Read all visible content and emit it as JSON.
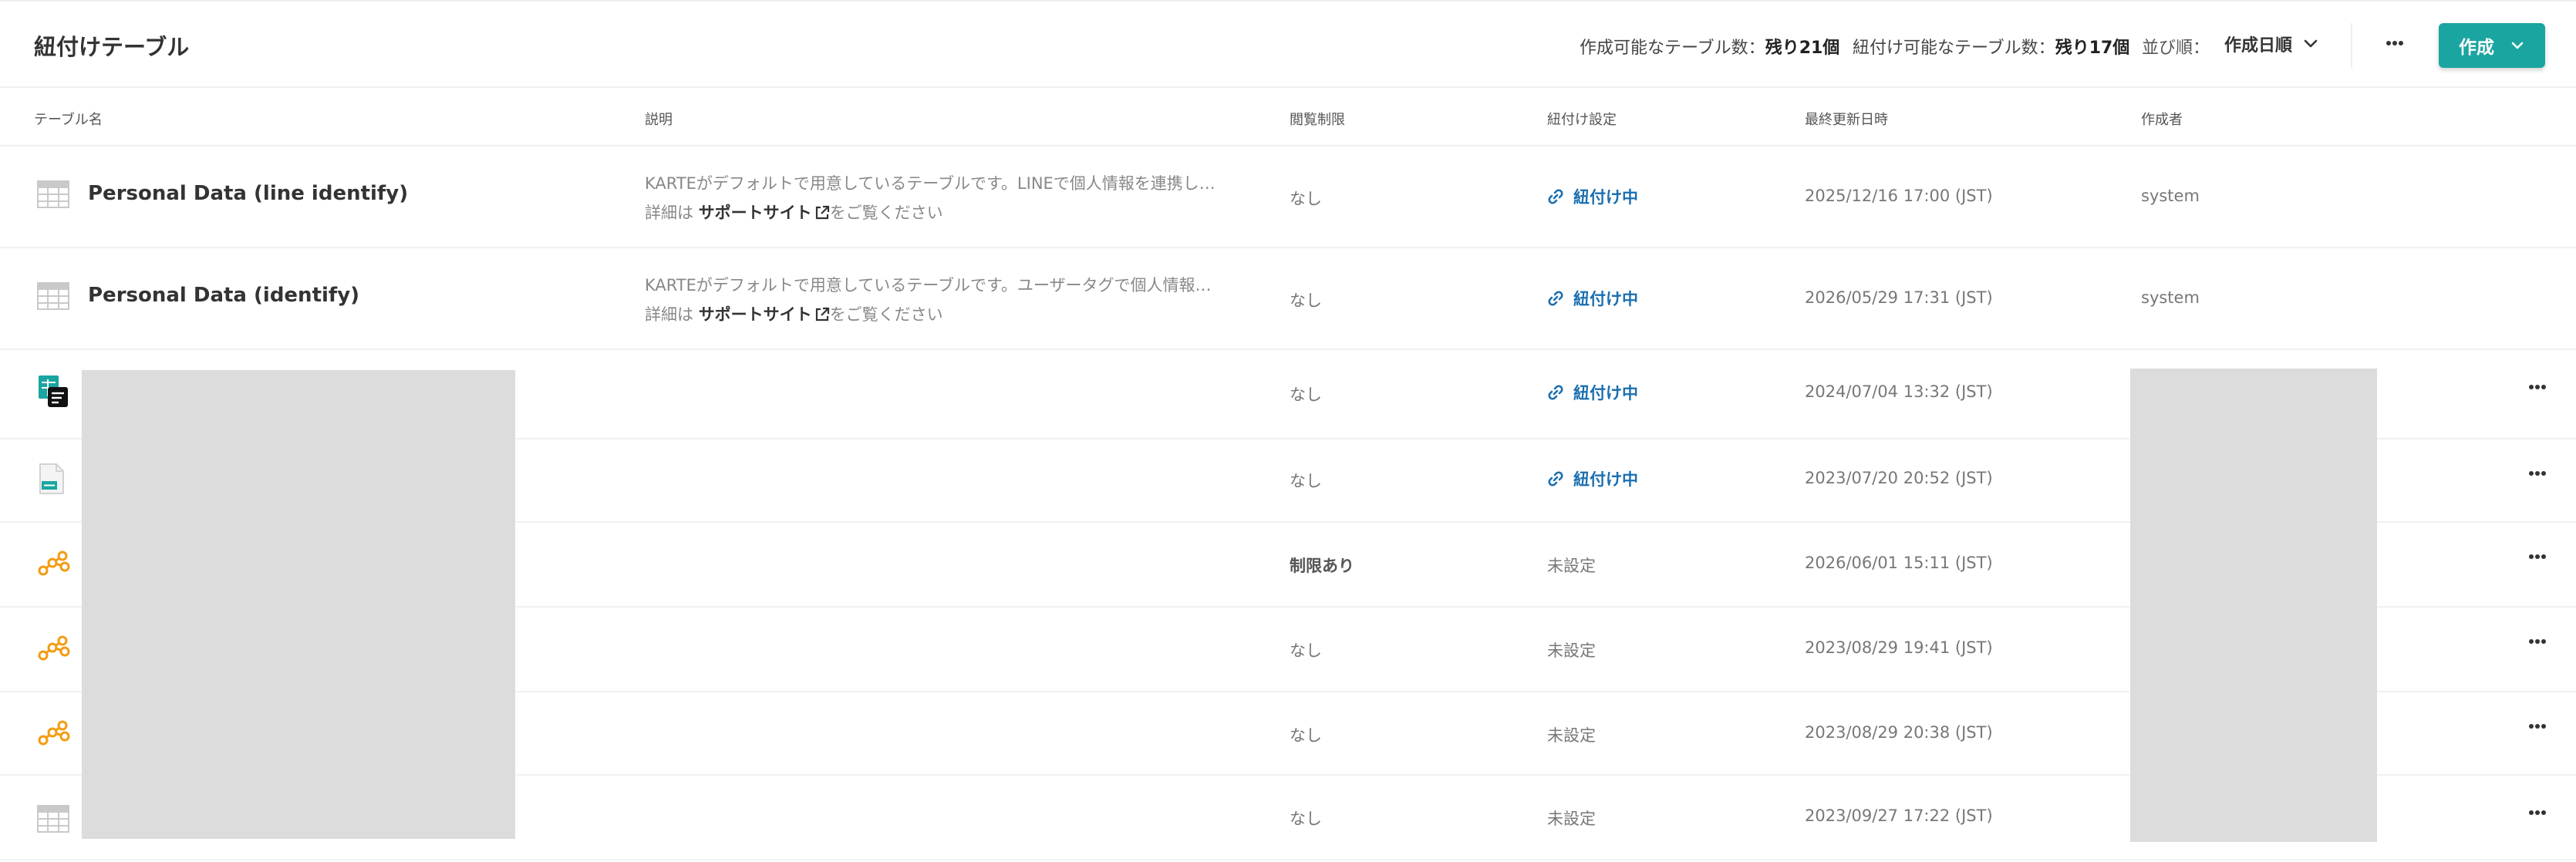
{
  "header": {
    "title": "紐付けテーブル",
    "creatable_label": "作成可能なテーブル数：",
    "creatable_value": "残り21個",
    "linkable_label": "紐付け可能なテーブル数：",
    "linkable_value": "残り17個",
    "sort_label": "並び順：",
    "sort_value": "作成日順",
    "create_label": "作成"
  },
  "columns": {
    "name": "テーブル名",
    "description": "説明",
    "access": "閲覧制限",
    "link": "紐付け設定",
    "updated": "最終更新日時",
    "author": "作成者"
  },
  "rows": [
    {
      "icon": "table-icon",
      "name": "Personal Data (line identify)",
      "desc_line1": "KARTEがデフォルトで用意しているテーブルです。LINEで個人情報を連携し…",
      "desc_prefix": "詳細は",
      "desc_link": "サポートサイト",
      "desc_suffix": "をご覧ください",
      "access": "なし",
      "link": "紐付け中",
      "updated": "2025/12/16 17:00 (JST)",
      "author": "system"
    },
    {
      "icon": "table-icon",
      "name": "Personal Data (identify)",
      "desc_line1": "KARTEがデフォルトで用意しているテーブルです。ユーザータグで個人情報…",
      "desc_prefix": "詳細は",
      "desc_link": "サポートサイト",
      "desc_suffix": "をご覧ください",
      "access": "なし",
      "link": "紐付け中",
      "updated": "2026/05/29 17:31 (JST)",
      "author": "system"
    },
    {
      "icon": "sheet-icon",
      "access": "なし",
      "link": "紐付け中",
      "updated": "2024/07/04 13:32 (JST)"
    },
    {
      "icon": "csv-file-icon",
      "access": "なし",
      "link": "紐付け中",
      "updated": "2023/07/20 20:52 (JST)"
    },
    {
      "icon": "connector-icon",
      "access": "制限あり",
      "link": "未設定",
      "updated": "2026/06/01 15:11 (JST)"
    },
    {
      "icon": "connector-icon",
      "access": "なし",
      "link": "未設定",
      "updated": "2023/08/29 19:41 (JST)"
    },
    {
      "icon": "connector-icon",
      "access": "なし",
      "link": "未設定",
      "updated": "2023/08/29 20:38 (JST)"
    },
    {
      "icon": "table-icon",
      "access": "なし",
      "link": "未設定",
      "updated": "2023/09/27 17:22 (JST)"
    }
  ],
  "colors": {
    "accent": "#1aa5a0",
    "link": "#1c6fb0",
    "redaction": "#dcdcdc",
    "connector_icon": "#f39c12"
  }
}
